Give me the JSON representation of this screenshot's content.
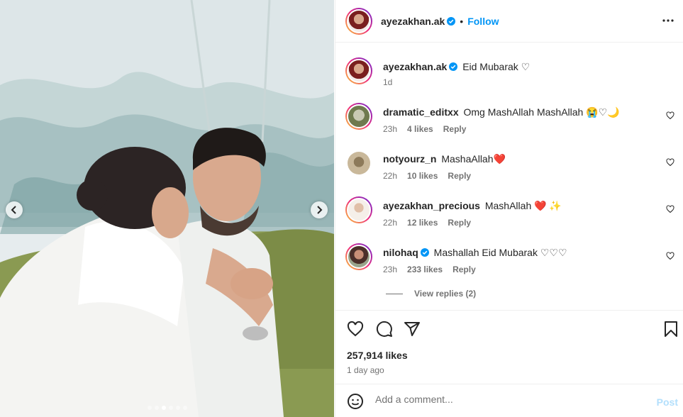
{
  "header": {
    "username": "ayezakhan.ak",
    "separator": "•",
    "follow_label": "Follow"
  },
  "caption": {
    "username": "ayezakhan.ak",
    "text": "Eid Mubarak ♡",
    "time": "1d"
  },
  "comments": [
    {
      "username": "dramatic_editxx",
      "verified": false,
      "text": "Omg MashAllah MashAllah 😭♡🌙",
      "time": "23h",
      "likes": "4 likes",
      "reply": "Reply"
    },
    {
      "username": "notyourz_n",
      "verified": false,
      "text": "MashaAllah❤️",
      "time": "22h",
      "likes": "10 likes",
      "reply": "Reply"
    },
    {
      "username": "ayezakhan_precious",
      "verified": false,
      "text": "MashAllah ❤️ ✨",
      "time": "22h",
      "likes": "12 likes",
      "reply": "Reply"
    },
    {
      "username": "nilohaq",
      "verified": true,
      "text": "Mashallah Eid Mubarak ♡♡♡",
      "time": "23h",
      "likes": "233 likes",
      "reply": "Reply"
    }
  ],
  "view_replies": "View replies (2)",
  "post": {
    "likes": "257,914 likes",
    "posted": "1 day ago"
  },
  "add_comment": {
    "placeholder": "Add a comment...",
    "post_label": "Post"
  },
  "carousel": {
    "slide_count": 6,
    "active_index": 2
  },
  "icons": [
    "more-icon",
    "verified-icon",
    "heart-icon",
    "comment-icon",
    "share-icon",
    "bookmark-icon",
    "emoji-icon",
    "chevron-left-icon",
    "chevron-right-icon"
  ],
  "colors": {
    "link": "#0095f6",
    "post_disabled": "#b2dffc",
    "muted": "#737373",
    "text": "#262626",
    "red_heart": "#ff3040"
  }
}
